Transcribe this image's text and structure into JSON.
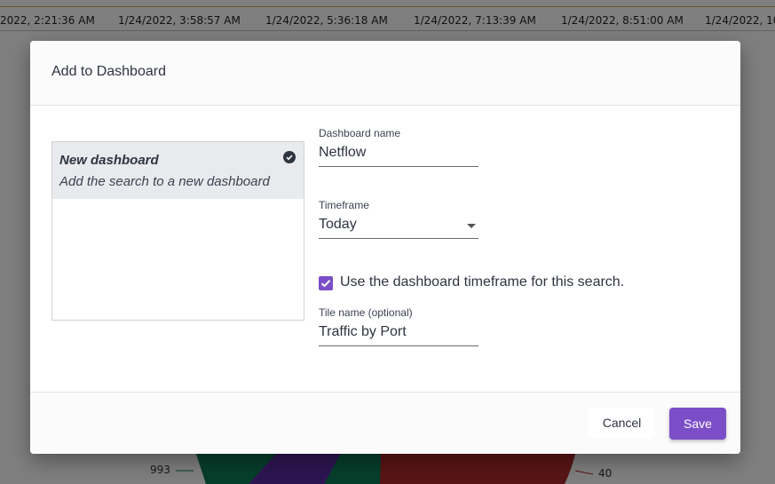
{
  "background": {
    "axis_ticks": [
      "2022, 2:21:36 AM",
      "1/24/2022, 3:58:57 AM",
      "1/24/2022, 5:36:18 AM",
      "1/24/2022, 7:13:39 AM",
      "1/24/2022, 8:51:00 AM",
      "1/24/2022, 10"
    ],
    "pie_label_left": "993",
    "pie_label_right": "40",
    "colors": {
      "green": "#0c7d59",
      "purple": "#5b2aa4",
      "red": "#b22b2b"
    }
  },
  "dialog": {
    "title": "Add to Dashboard",
    "dashboard_option": {
      "title": "New dashboard",
      "subtitle": "Add the search to a new dashboard",
      "selected_icon": "check-circle-icon"
    },
    "dashboard_name": {
      "label": "Dashboard name",
      "value": "Netflow"
    },
    "timeframe": {
      "label": "Timeframe",
      "value": "Today"
    },
    "use_dashboard_timeframe": {
      "label": "Use the dashboard timeframe for this search.",
      "checked": true
    },
    "tile_name": {
      "label": "Tile name (optional)",
      "value": "Traffic by Port"
    },
    "cancel_label": "Cancel",
    "save_label": "Save",
    "accent_color": "#7b4ec8"
  }
}
